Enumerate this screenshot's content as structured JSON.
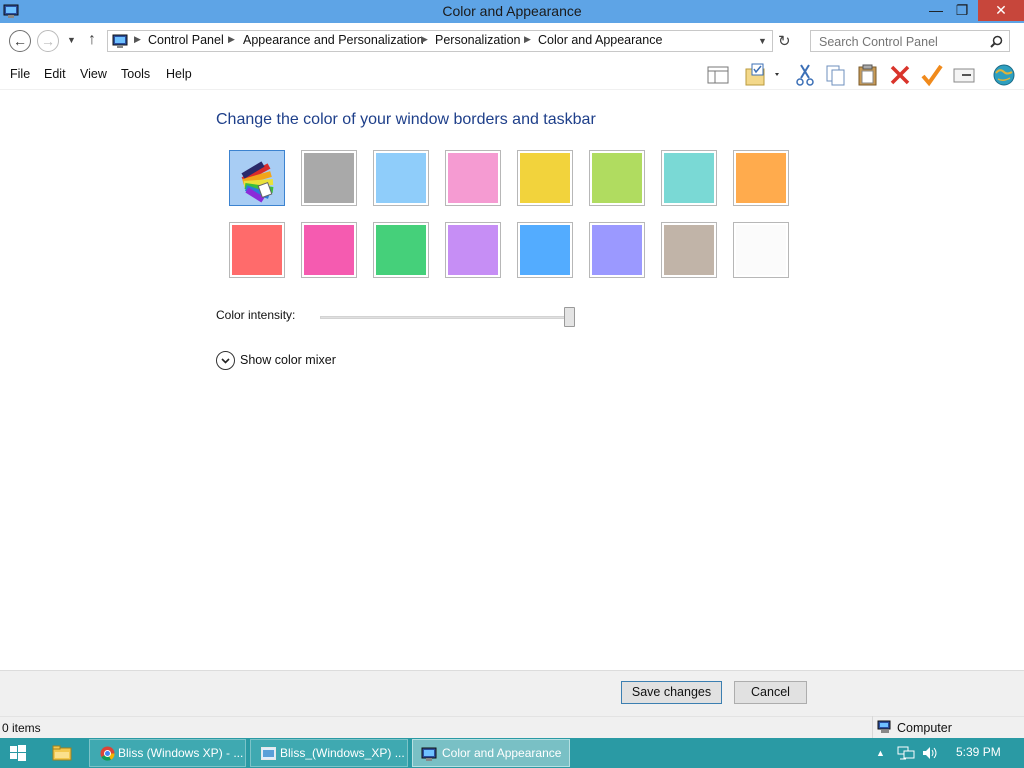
{
  "window": {
    "title": "Color and Appearance",
    "minimize_glyph": "—",
    "maximize_glyph": "❐",
    "close_glyph": "✕"
  },
  "nav": {
    "back_glyph": "←",
    "forward_glyph": "→",
    "up_glyph": "↑",
    "refresh_glyph": "↻",
    "breadcrumbs": [
      "Control Panel",
      "Appearance and Personalization",
      "Personalization",
      "Color and Appearance"
    ],
    "search_placeholder": "Search Control Panel"
  },
  "menu": [
    "File",
    "Edit",
    "View",
    "Tools",
    "Help"
  ],
  "toolbar_icons": [
    "layout-pane-icon",
    "folder-options-icon",
    "cut-icon",
    "copy-icon",
    "paste-icon",
    "delete-icon",
    "checkmark-icon",
    "properties-icon",
    "globe-icon"
  ],
  "content": {
    "heading": "Change the color of your window borders and taskbar",
    "swatches_row1": [
      "automatic",
      "#a9a9a9",
      "#8fcdfa",
      "#f59bd2",
      "#f2d33c",
      "#b0dc60",
      "#7ad9d5",
      "#ffab4d"
    ],
    "swatches_row2": [
      "#ff6b6b",
      "#f55bb0",
      "#45d07a",
      "#c68ef5",
      "#53acff",
      "#9b99ff",
      "#c1b4a8",
      "#fbfbfb"
    ],
    "selected_swatch": "automatic",
    "intensity_label": "Color intensity:",
    "intensity_value": 1.0,
    "mixer_label": "Show color mixer"
  },
  "footer": {
    "save_label": "Save changes",
    "cancel_label": "Cancel"
  },
  "status": {
    "items": "0 items",
    "location": "Computer"
  },
  "taskbar": {
    "tasks": [
      {
        "label": "Bliss (Windows XP) - ...",
        "icon": "chrome-icon",
        "active": false
      },
      {
        "label": "Bliss_(Windows_XP) ...",
        "icon": "image-viewer-icon",
        "active": false
      },
      {
        "label": "Color and Appearance",
        "icon": "control-panel-icon",
        "active": true
      }
    ],
    "clock": "5:39 PM"
  }
}
